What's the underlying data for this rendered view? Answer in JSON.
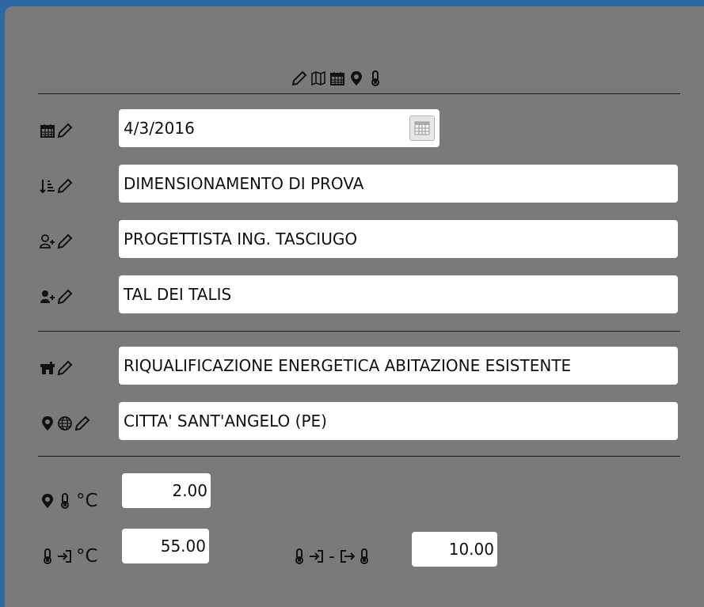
{
  "header": {
    "icons": [
      "pencil-icon",
      "map-icon",
      "calendar-icon",
      "map-marker-icon",
      "thermometer-icon"
    ]
  },
  "fields": {
    "date": {
      "value": "4/3/2016",
      "icons": [
        "calendar-icon",
        "pencil-icon"
      ]
    },
    "description": {
      "value": "DIMENSIONAMENTO DI PROVA",
      "icons": [
        "sort-list-icon",
        "pencil-icon"
      ]
    },
    "designer": {
      "value": "PROGETTISTA ING. TASCIUGO",
      "icons": [
        "user-add-outline-icon",
        "pencil-icon"
      ]
    },
    "client": {
      "value": "TAL DEI TALIS",
      "icons": [
        "user-add-icon",
        "pencil-icon"
      ]
    },
    "building": {
      "value": "RIQUALIFICAZIONE ENERGETICA ABITAZIONE ESISTENTE",
      "icons": [
        "house-icon",
        "pencil-icon"
      ]
    },
    "location": {
      "value": "CITTA' SANT'ANGELO (PE)",
      "icons": [
        "map-marker-icon",
        "globe-icon",
        "pencil-icon"
      ]
    }
  },
  "temperatures": {
    "outdoor": {
      "value": "2.00",
      "unit": "°C"
    },
    "inlet": {
      "value": "55.00",
      "unit": "°C"
    },
    "delta": {
      "value": "10.00",
      "separator": "-"
    }
  }
}
